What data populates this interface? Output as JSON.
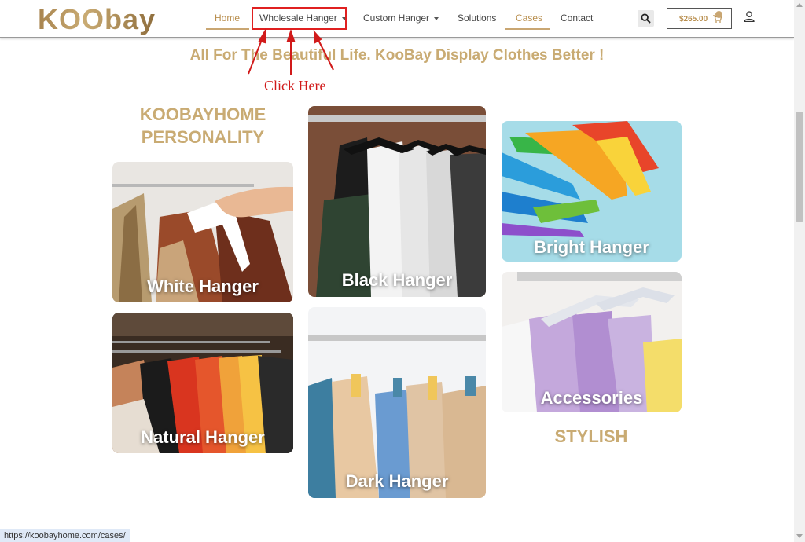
{
  "header": {
    "logo": "KOObay",
    "nav": [
      {
        "label": "Home",
        "active": true
      },
      {
        "label": "Wholesale Hanger",
        "has_dropdown": true
      },
      {
        "label": "Custom Hanger",
        "has_dropdown": true
      },
      {
        "label": "Solutions"
      },
      {
        "label": "Cases",
        "active": true
      },
      {
        "label": "Contact"
      }
    ],
    "cart_total": "$265.00",
    "search_icon": "search-icon",
    "cart_icon": "cart-icon",
    "user_icon": "user-icon"
  },
  "tagline": "All For The Beautiful Life. KooBay Display Clothes Better !",
  "annotation": {
    "text": "Click Here",
    "color": "#d11a1a"
  },
  "headings": {
    "personality": "KOOBAYHOME PERSONALITY",
    "stylish": "STYLISH"
  },
  "cards": [
    {
      "label": "White Hanger"
    },
    {
      "label": "Natural Hanger"
    },
    {
      "label": "Black Hanger"
    },
    {
      "label": "Dark Hanger"
    },
    {
      "label": "Bright Hanger"
    },
    {
      "label": "Accessories"
    }
  ],
  "status_bar": {
    "url": "https://koobayhome.com/cases/"
  },
  "colors": {
    "accent": "#c9ab73",
    "nav_text": "#444444",
    "highlight": "#e02020"
  }
}
